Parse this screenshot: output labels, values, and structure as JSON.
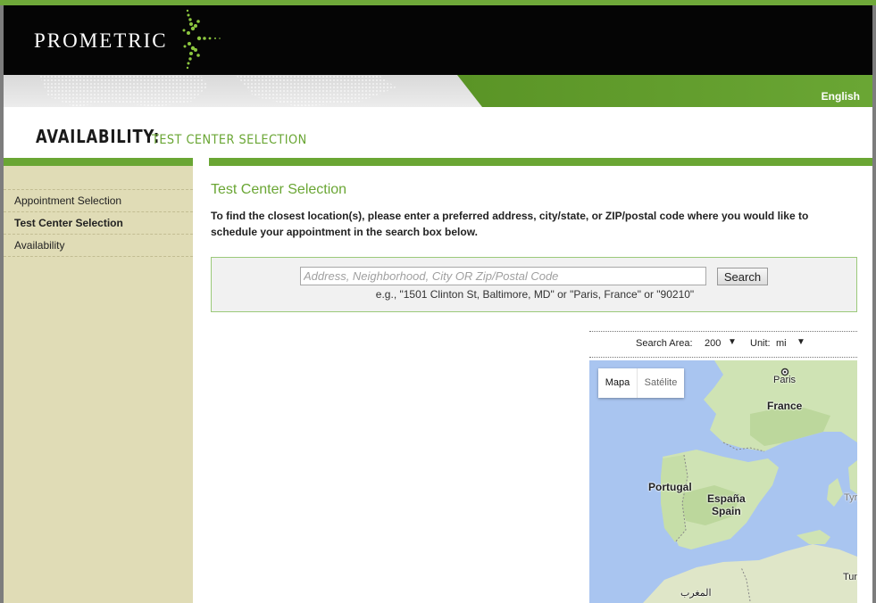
{
  "brand": {
    "logo_text": "PROMETRIC"
  },
  "header": {
    "language": "English"
  },
  "page": {
    "title": "AVAILABILITY:",
    "subtitle": "TEST CENTER SELECTION"
  },
  "sidebar": {
    "items": [
      {
        "label": "Appointment Selection",
        "active": false
      },
      {
        "label": "Test Center Selection",
        "active": true
      },
      {
        "label": "Availability",
        "active": false
      }
    ]
  },
  "main": {
    "section_title": "Test Center Selection",
    "instructions": "To find the closest location(s), please enter a preferred address, city/state, or ZIP/postal code where you would like to schedule your appointment in the search box below.",
    "search": {
      "placeholder": "Address, Neighborhood, City OR Zip/Postal Code",
      "value": "",
      "button_label": "Search",
      "example": "e.g., \"1501 Clinton St, Baltimore, MD\" or \"Paris, France\" or \"90210\""
    }
  },
  "map_controls": {
    "search_area_label": "Search Area:",
    "search_area_value": "200",
    "unit_label": "Unit:",
    "unit_value": "mi"
  },
  "map": {
    "type_buttons": [
      "Mapa",
      "Satélite"
    ],
    "labels": [
      "Paris",
      "France",
      "Portugal",
      "España",
      "Spain",
      "المغرب",
      "Tyr",
      "Tun"
    ]
  },
  "colors": {
    "accent_green": "#6aa634",
    "sidebar_bg": "#e0dcb6",
    "header_bg": "#050505"
  },
  "icons": {
    "logo_mark": "starburst-dots-icon",
    "dropdown": "triangle-down-icon",
    "city_marker": "dot-marker-icon"
  }
}
